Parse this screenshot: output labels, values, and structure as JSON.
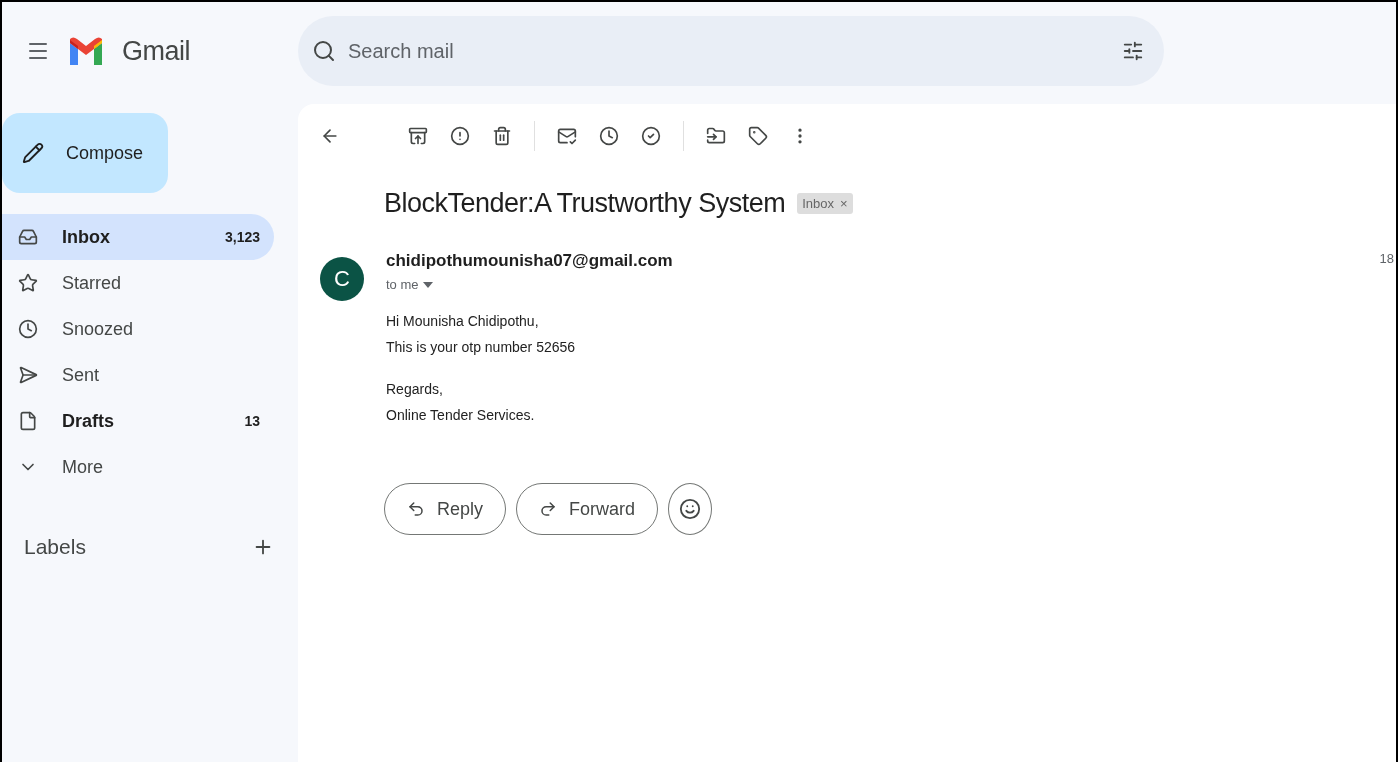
{
  "header": {
    "app_name": "Gmail",
    "search": {
      "placeholder": "Search mail"
    }
  },
  "compose": {
    "label": "Compose"
  },
  "nav": [
    {
      "kind": "inbox",
      "label": "Inbox",
      "count": "3,123",
      "selected": true,
      "unread": true
    },
    {
      "kind": "star",
      "label": "Starred",
      "selected": false,
      "unread": false
    },
    {
      "kind": "clock",
      "label": "Snoozed",
      "selected": false,
      "unread": false
    },
    {
      "kind": "send",
      "label": "Sent",
      "selected": false,
      "unread": false
    },
    {
      "kind": "file",
      "label": "Drafts",
      "count": "13",
      "selected": false,
      "unread": true
    },
    {
      "kind": "more",
      "label": "More",
      "selected": false,
      "unread": false
    }
  ],
  "labels": {
    "heading": "Labels"
  },
  "message": {
    "subject": "BlockTender:A Trustworthy System",
    "tag": {
      "label": "Inbox",
      "close": "×"
    },
    "avatar": "C",
    "sender": "chidipothumounisha07@gmail.com",
    "recipient": "to me",
    "time": "18",
    "body": [
      [
        "Hi Mounisha Chidipothu,",
        "This is your otp number 52656"
      ],
      [
        "Regards,",
        "Online Tender Services."
      ]
    ],
    "actions": [
      {
        "kind": "reply",
        "label": "Reply"
      },
      {
        "kind": "forward",
        "label": "Forward"
      }
    ]
  }
}
